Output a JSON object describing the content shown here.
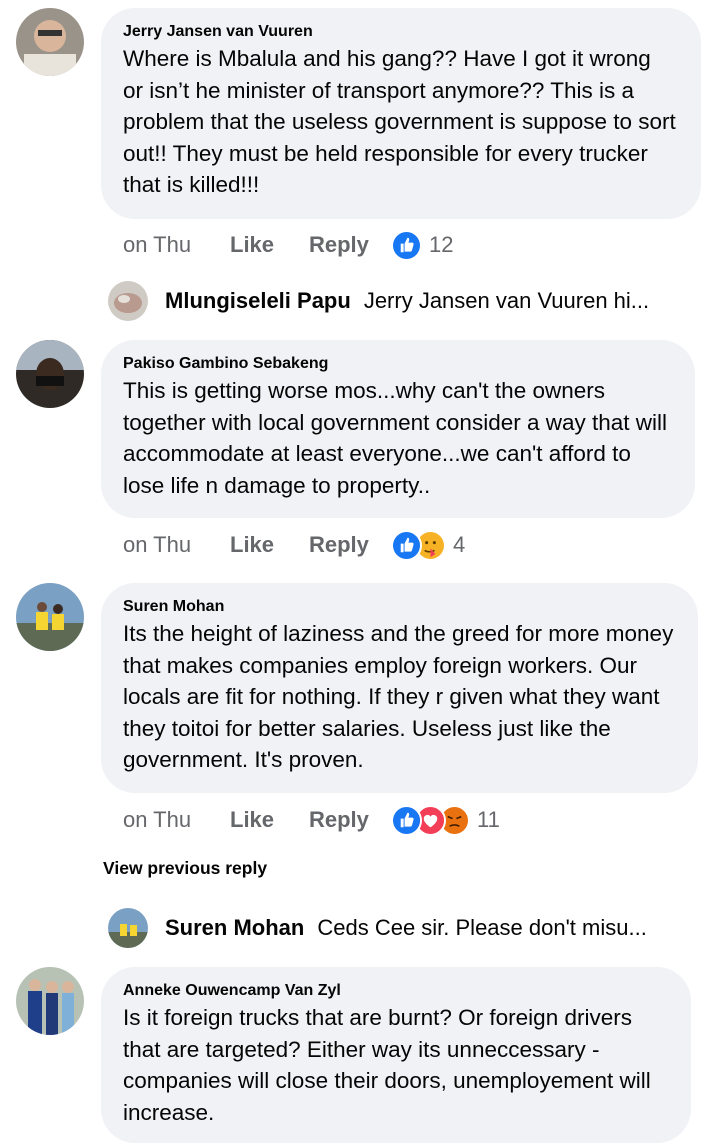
{
  "comments": [
    {
      "author": "Jerry Jansen van Vuuren",
      "text": "Where is Mbalula and his gang?? Have I got it wrong or isn’t he minister of transport anymore?? This is a problem that the useless government is suppose to sort out!! They must be held responsible for every trucker that is killed!!!",
      "time": "on Thu",
      "like": "Like",
      "reply": "Reply",
      "reactions": [
        "like"
      ],
      "reaction_count": "12"
    },
    {
      "author": "Pakiso Gambino Sebakeng",
      "text": "This is getting worse mos...why can't the owners together with local government consider a way that will accommodate at least everyone...we can't afford to lose life n damage to property..",
      "time": "on Thu",
      "like": "Like",
      "reply": "Reply",
      "reactions": [
        "like",
        "care"
      ],
      "reaction_count": "4"
    },
    {
      "author": "Suren Mohan",
      "text": "Its the height of laziness and the greed for more money that makes companies employ foreign workers. Our locals are fit for nothing. If they r given what they want they toitoi for better salaries. Useless just like the government. It's proven.",
      "time": "on Thu",
      "like": "Like",
      "reply": "Reply",
      "reactions": [
        "like",
        "love",
        "angry"
      ],
      "reaction_count": "11"
    },
    {
      "author": "Anneke Ouwencamp Van Zyl",
      "text": "Is it foreign trucks that are burnt? Or foreign drivers that are targeted? Either way its unneccessary - companies will close their doors, unemployement will increase."
    }
  ],
  "replies": [
    {
      "author": "Mlungiseleli Papu",
      "text": "Jerry Jansen van Vuuren hi..."
    },
    {
      "author": "Suren Mohan",
      "text": "Ceds Cee sir. Please don't misu..."
    }
  ],
  "view_previous_reply": "View previous reply",
  "colors": {
    "bubble": "#f0f2f5",
    "meta": "#65676b",
    "like_blue": "#1877f2",
    "love_red": "#f33e58",
    "angry_orange": "#e9710f"
  }
}
